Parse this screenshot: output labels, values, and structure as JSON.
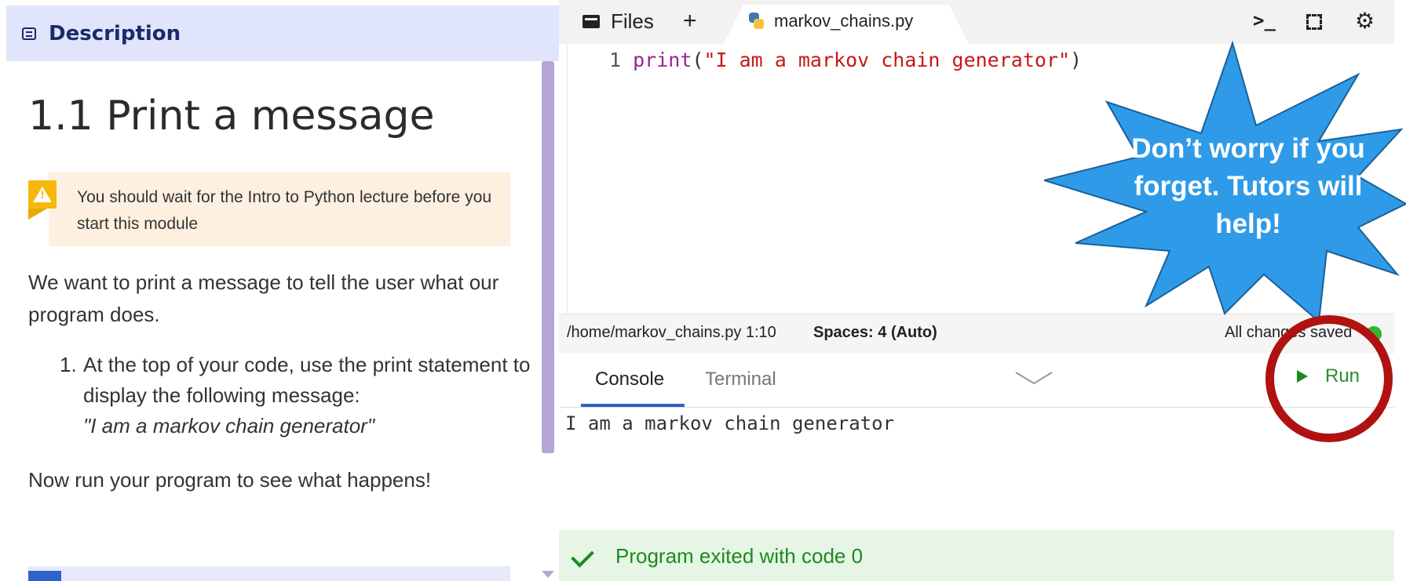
{
  "description_panel": {
    "header_label": "Description",
    "lesson_title": "1.1 Print a message",
    "warning": {
      "text": "You should wait for the Intro to Python lecture before you start this module"
    },
    "intro_paragraph": "We want to print a message to tell the user what our program does.",
    "steps": [
      {
        "number": "1.",
        "text": "At the top of your code, use the print statement to display the following message:",
        "quote": "\"I am a markov chain generator\""
      }
    ],
    "closing_paragraph": "Now run your program to see what happens!"
  },
  "editor": {
    "files_tab_label": "Files",
    "add_tab_label": "+",
    "active_file_tab": "markov_chains.py",
    "code_lines": [
      {
        "line_number": "1",
        "keyword": "print",
        "open": "(",
        "string": "\"I am a markov chain generator\"",
        "close": ")"
      }
    ],
    "toolbar_icons": [
      "terminal-icon",
      "fullscreen-icon",
      "gear-icon"
    ]
  },
  "statusbar": {
    "path_and_position": "/home/markov_chains.py 1:10",
    "spaces": "Spaces: 4 (Auto)",
    "save_status": "All changes saved"
  },
  "console": {
    "tabs": [
      "Console",
      "Terminal"
    ],
    "active_tab": "Console",
    "run_label": "Run",
    "output": "I am a markov chain generator",
    "exit_message": "Program exited with code 0"
  },
  "callout": {
    "text": "Don’t worry if you forget. Tutors will help!",
    "color": "#2f9be8"
  },
  "highlight_color": "#b01212"
}
